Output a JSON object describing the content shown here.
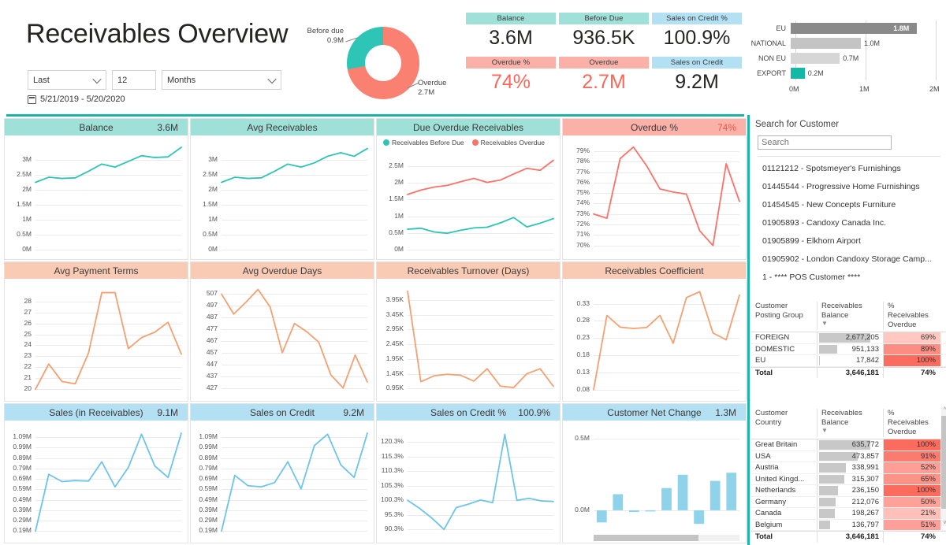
{
  "header": {
    "title": "Receivables Overview",
    "filters": {
      "range_label": "Last",
      "count_value": "12",
      "unit_label": "Months",
      "date_range": "5/21/2019 - 5/20/2020",
      "calendar_icon": "calendar-icon",
      "chevron_icon": "chevron-down-icon"
    },
    "donut": {
      "before_due_label": "Before due",
      "before_due_value": "0.9M",
      "overdue_label": "Overdue",
      "overdue_value": "2.7M",
      "before_due_color": "#2ec4b6",
      "overdue_color": "#fa8072"
    },
    "kpis": [
      {
        "label": "Balance",
        "value": "3.6M",
        "head_color": "#9fe0d8",
        "value_color": "#252423"
      },
      {
        "label": "Before Due",
        "value": "936.5K",
        "head_color": "#9fe0d8",
        "value_color": "#252423"
      },
      {
        "label": "Sales on Credit %",
        "value": "100.9%",
        "head_color": "#b3e0f2",
        "value_color": "#252423"
      },
      {
        "label": "Overdue %",
        "value": "74%",
        "head_color": "#fbb0a8",
        "value_color": "#f8695c"
      },
      {
        "label": "Overdue",
        "value": "2.7M",
        "head_color": "#fbb0a8",
        "value_color": "#f8695c"
      },
      {
        "label": "Sales on Credit",
        "value": "9.2M",
        "head_color": "#b3e0f2",
        "value_color": "#252423"
      }
    ]
  },
  "chart_data": [
    {
      "id": "posting_group_bars",
      "type": "bar",
      "title": "",
      "orientation": "horizontal",
      "categories": [
        "EU",
        "NATIONAL",
        "NON EU",
        "EXPORT"
      ],
      "values": [
        1.8,
        1.0,
        0.7,
        0.2
      ],
      "value_labels": [
        "1.8M",
        "1.0M",
        "0.7M",
        "0.2M"
      ],
      "colors": [
        "#8a8a8a",
        "#c4c4c4",
        "#d6d6d6",
        "#14b8a6"
      ],
      "xlim": [
        0,
        2
      ],
      "xticks": [
        "0M",
        "1M",
        "2M"
      ],
      "xlabel": "",
      "ylabel": "",
      "grid": true
    },
    {
      "id": "balance",
      "type": "line",
      "title": "Balance",
      "value": "3.6M",
      "header_color": "#9fe0d8",
      "line_color": "#2ec4b6",
      "yticks": [
        "3M",
        "2.5M",
        "2M",
        "1.5M",
        "1M",
        "0.5M",
        "0M"
      ],
      "ylim": [
        0,
        3.5
      ],
      "values": [
        2.25,
        2.42,
        2.38,
        2.4,
        2.62,
        2.86,
        2.76,
        2.95,
        3.14,
        3.08,
        3.1,
        3.42
      ],
      "xlabel": "",
      "ylabel": "",
      "grid": true
    },
    {
      "id": "avg_receivables",
      "type": "line",
      "title": "Avg Receivables",
      "value": "",
      "header_color": "#9fe0d8",
      "line_color": "#2ec4b6",
      "yticks": [
        "3M",
        "2.5M",
        "2M",
        "1.5M",
        "1M",
        "0.5M",
        "0M"
      ],
      "ylim": [
        0,
        3.5
      ],
      "values": [
        2.25,
        2.42,
        2.38,
        2.4,
        2.62,
        2.86,
        2.76,
        2.9,
        3.12,
        3.24,
        3.12,
        3.38
      ],
      "xlabel": "",
      "ylabel": "",
      "grid": true
    },
    {
      "id": "due_overdue_receivables",
      "type": "line",
      "title": "Due Overdue Receivables",
      "value": "",
      "header_color": "#9fe0d8",
      "legend": [
        "Receivables Before Due",
        "Receivables Overdue"
      ],
      "legend_colors": [
        "#2ec4b6",
        "#fa7268"
      ],
      "yticks": [
        "2.5M",
        "2M",
        "1.5M",
        "1M",
        "0.5M",
        "0M"
      ],
      "ylim": [
        0,
        2.8
      ],
      "series": [
        {
          "name": "Receivables Before Due",
          "color": "#2ec4b6",
          "values": [
            0.61,
            0.64,
            0.53,
            0.49,
            0.58,
            0.65,
            0.67,
            0.8,
            0.96,
            0.68,
            0.79,
            0.93
          ]
        },
        {
          "name": "Receivables Overdue",
          "color": "#fa7268",
          "values": [
            1.65,
            1.78,
            1.87,
            1.92,
            2.03,
            2.13,
            2.01,
            2.08,
            2.26,
            2.43,
            2.37,
            2.67
          ]
        }
      ],
      "xlabel": "",
      "ylabel": "",
      "grid": true
    },
    {
      "id": "overdue_pct",
      "type": "line",
      "title": "Overdue %",
      "value": "74%",
      "header_color": "#fbb0a8",
      "line_color": "#fa7268",
      "yticks": [
        "79%",
        "78%",
        "77%",
        "76%",
        "75%",
        "74%",
        "73%",
        "72%",
        "71%",
        "70%"
      ],
      "ylim": [
        69.6,
        79.6
      ],
      "values": [
        73.0,
        72.6,
        78.3,
        79.4,
        77.6,
        75.4,
        75.1,
        74.9,
        71.4,
        70.0,
        77.8,
        74.2
      ],
      "xlabel": "",
      "ylabel": "",
      "grid": true
    },
    {
      "id": "avg_payment_terms",
      "type": "line",
      "title": "Avg Payment Terms",
      "value": "",
      "header_color": "#f9cbb5",
      "line_color": "#f4a071",
      "yticks": [
        "28",
        "27",
        "26",
        "25",
        "24",
        "23",
        "22",
        "21",
        "20"
      ],
      "ylim": [
        19.8,
        29.2
      ],
      "values": [
        20.0,
        22.3,
        20.7,
        20.5,
        23.3,
        28.8,
        28.8,
        23.7,
        24.7,
        25.2,
        26.1,
        23.2
      ],
      "xlabel": "",
      "ylabel": "",
      "grid": true
    },
    {
      "id": "avg_overdue_days",
      "type": "line",
      "title": "Avg Overdue Days",
      "value": "",
      "header_color": "#f9cbb5",
      "line_color": "#f4a071",
      "yticks": [
        "507",
        "497",
        "487",
        "477",
        "467",
        "457",
        "447",
        "437",
        "427"
      ],
      "ylim": [
        424,
        512
      ],
      "values": [
        507,
        490,
        500,
        511,
        496,
        457,
        482,
        475,
        466,
        438,
        427,
        455,
        432
      ],
      "xlabel": "",
      "ylabel": "",
      "grid": true
    },
    {
      "id": "receivables_turnover",
      "type": "line",
      "title": "Receivables Turnover (Days)",
      "value": "",
      "header_color": "#f9cbb5",
      "line_color": "#f4a071",
      "yticks": [
        "3.95K",
        "3.45K",
        "2.95K",
        "2.45K",
        "1.95K",
        "1.45K",
        "0.95K"
      ],
      "ylim": [
        0.85,
        4.35
      ],
      "values": [
        4.25,
        1.18,
        1.38,
        1.43,
        1.4,
        1.2,
        1.62,
        1.03,
        0.98,
        1.45,
        1.62,
        1.02
      ],
      "xlabel": "",
      "ylabel": "",
      "grid": true
    },
    {
      "id": "receivables_coefficient",
      "type": "line",
      "title": "Receivables Coefficient",
      "value": "",
      "header_color": "#f9cbb5",
      "line_color": "#f4a071",
      "yticks": [
        "0.33",
        "0.28",
        "0.23",
        "0.18",
        "0.13",
        "0.08"
      ],
      "ylim": [
        0.075,
        0.375
      ],
      "values": [
        0.08,
        0.296,
        0.262,
        0.258,
        0.261,
        0.296,
        0.215,
        0.348,
        0.365,
        0.245,
        0.225,
        0.355
      ],
      "xlabel": "",
      "ylabel": "",
      "grid": true
    },
    {
      "id": "sales_in_receivables",
      "type": "line",
      "title": "Sales (in Receivables)",
      "value": "9.1M",
      "header_color": "#b3e0f2",
      "line_color": "#6cc5e8",
      "yticks": [
        "1.09M",
        "0.99M",
        "0.89M",
        "0.79M",
        "0.69M",
        "0.59M",
        "0.49M",
        "0.39M",
        "0.29M",
        "0.19M"
      ],
      "ylim": [
        0.17,
        1.16
      ],
      "values": [
        0.19,
        0.735,
        0.665,
        0.675,
        0.67,
        0.855,
        0.615,
        0.8,
        1.12,
        0.815,
        0.705,
        1.13
      ],
      "xlabel": "",
      "ylabel": "",
      "grid": true
    },
    {
      "id": "sales_on_credit",
      "type": "line",
      "title": "Sales on Credit",
      "value": "9.2M",
      "header_color": "#b3e0f2",
      "line_color": "#6cc5e8",
      "yticks": [
        "1.09M",
        "0.99M",
        "0.89M",
        "0.79M",
        "0.69M",
        "0.59M",
        "0.49M",
        "0.39M",
        "0.29M",
        "0.19M"
      ],
      "ylim": [
        0.17,
        1.16
      ],
      "values": [
        0.19,
        0.725,
        0.625,
        0.615,
        0.655,
        0.855,
        0.595,
        1.01,
        1.12,
        0.825,
        0.705,
        1.13
      ],
      "xlabel": "",
      "ylabel": "",
      "grid": true
    },
    {
      "id": "sales_on_credit_pct",
      "type": "line",
      "title": "Sales on Credit %",
      "value": "100.9%",
      "header_color": "#b3e0f2",
      "line_color": "#6cc5e8",
      "yticks": [
        "120.3%",
        "115.3%",
        "110.3%",
        "105.3%",
        "100.3%",
        "95.3%",
        "90.3%"
      ],
      "ylim": [
        89.0,
        124.5
      ],
      "values": [
        100.3,
        97.5,
        94.2,
        90.3,
        97.8,
        99.0,
        100.4,
        99.5,
        123.0,
        100.3,
        101.0,
        100.1,
        99.9
      ],
      "xlabel": "",
      "ylabel": "",
      "grid": true
    },
    {
      "id": "customer_net_change",
      "type": "bar",
      "title": "Customer Net Change",
      "value": "1.3M",
      "header_color": "#b3e0f2",
      "bar_color": "#8fd3ea",
      "yticks": [
        "0.5M",
        "0.0M"
      ],
      "ylim": [
        -0.16,
        0.56
      ],
      "values": [
        -0.085,
        0.112,
        -0.012,
        -0.005,
        0.155,
        0.248,
        -0.095,
        0.205,
        0.262
      ],
      "xlabel": "",
      "ylabel": "",
      "grid": true
    }
  ],
  "sidebar": {
    "search_title": "Search for Customer",
    "search_placeholder": "Search",
    "search_value": "",
    "customers": [
      "01121212 - Spotsmeyer's Furnishings",
      "01445544 - Progressive Home Furnishings",
      "01454545 - New Concepts Furniture",
      "01905893 - Candoxy Canada Inc.",
      "01905899 - Elkhorn Airport",
      "01905902 - London Candoxy Storage Camp...",
      "1 - **** POS Customer ****"
    ],
    "posting_group_table": {
      "columns": [
        "Customer Posting Group",
        "Receivables Balance",
        "% Receivables Overdue"
      ],
      "sort_icon": "sort-descending-icon",
      "rows": [
        {
          "name": "FOREIGN",
          "balance": "2,677,205",
          "pct": "69%",
          "bar": 100,
          "pct_color": "#ffc9c2"
        },
        {
          "name": "DOMESTIC",
          "balance": "951,133",
          "pct": "89%",
          "bar": 36,
          "pct_color": "#fc8d82"
        },
        {
          "name": "EU",
          "balance": "17,842",
          "pct": "100%",
          "bar": 1,
          "pct_color": "#fb6b5e"
        }
      ],
      "total": {
        "name": "Total",
        "balance": "3,646,181",
        "pct": "74%"
      }
    },
    "country_table": {
      "columns": [
        "Customer Country",
        "Receivables Balance",
        "% Receivables Overdue"
      ],
      "sort_icon": "sort-descending-icon",
      "rows": [
        {
          "name": "Great Britain",
          "balance": "635,772",
          "pct": "100%",
          "bar": 100,
          "pct_color": "#fb6b5e"
        },
        {
          "name": "USA",
          "balance": "473,857",
          "pct": "91%",
          "bar": 75,
          "pct_color": "#fc7b6f"
        },
        {
          "name": "Austria",
          "balance": "338,991",
          "pct": "52%",
          "bar": 53,
          "pct_color": "#fe9e95"
        },
        {
          "name": "United Kingd...",
          "balance": "315,307",
          "pct": "65%",
          "bar": 50,
          "pct_color": "#fd9287"
        },
        {
          "name": "Netherlands",
          "balance": "236,150",
          "pct": "100%",
          "bar": 37,
          "pct_color": "#fb6b5e"
        },
        {
          "name": "Germany",
          "balance": "212,076",
          "pct": "50%",
          "bar": 33,
          "pct_color": "#fea199"
        },
        {
          "name": "Canada",
          "balance": "198,267",
          "pct": "21%",
          "bar": 31,
          "pct_color": "#ffc0b9"
        },
        {
          "name": "Belgium",
          "balance": "136,797",
          "pct": "51%",
          "bar": 22,
          "pct_color": "#fea099"
        }
      ],
      "total": {
        "name": "Total",
        "balance": "3,646,181",
        "pct": "74%"
      }
    }
  }
}
